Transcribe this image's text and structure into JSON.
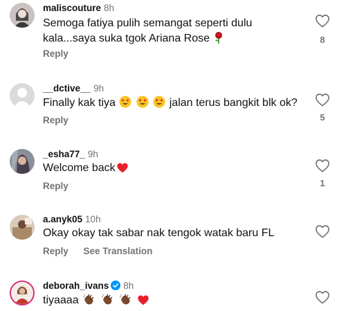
{
  "comments": [
    {
      "username": "maliscouture",
      "time": "8h",
      "text_line1": "Semoga fatiya pulih semangat seperti dulu",
      "text_line2": "kala...saya suka tgok Ariana Rose",
      "reply_label": "Reply",
      "like_count": "8"
    },
    {
      "username": "__dctive__",
      "time": "9h",
      "text_before": "Finally kak tiya",
      "text_after": "jalan terus bangkit blk ok?",
      "reply_label": "Reply",
      "like_count": "5"
    },
    {
      "username": "_esha77_",
      "time": "9h",
      "text": "Welcome back",
      "reply_label": "Reply",
      "like_count": "1"
    },
    {
      "username": "a.anyk05",
      "time": "10h",
      "text": "Okay okay tak sabar nak tengok watak baru FL",
      "reply_label": "Reply",
      "translation_label": "See Translation"
    },
    {
      "username": "deborah_ivans",
      "time": "8h",
      "text": "tiyaaaa"
    }
  ],
  "icons": {
    "like": "heart-outline-icon",
    "verified": "verified-badge-icon",
    "emoji_rose": "rose-emoji-icon",
    "emoji_heart_eyes": "heart-eyes-emoji-icon",
    "emoji_red_heart": "red-heart-emoji-icon",
    "emoji_clap": "clapping-hands-emoji-icon"
  },
  "colors": {
    "secondary_text": "#737373",
    "verified_blue": "#0095f6",
    "heart_red": "#e8202a"
  }
}
